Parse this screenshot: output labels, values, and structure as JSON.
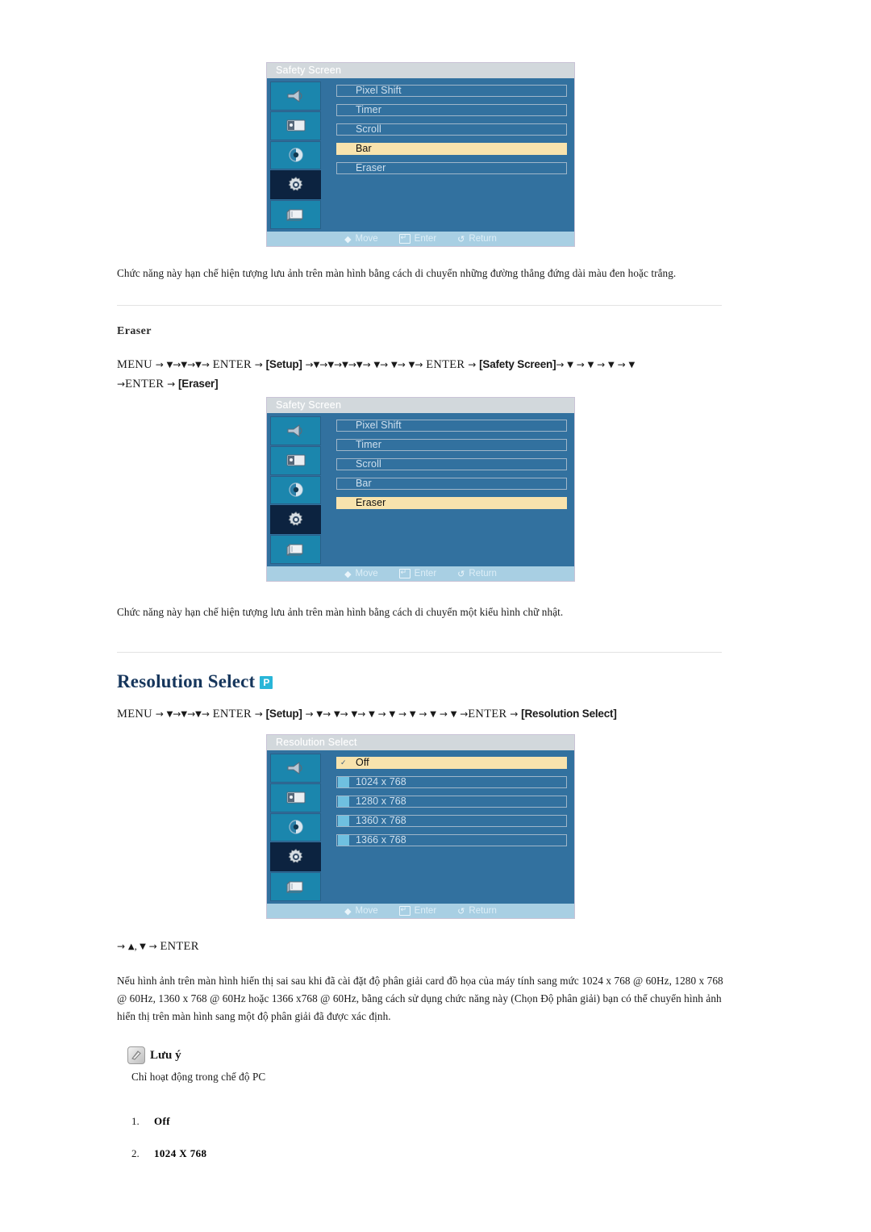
{
  "osd_menus": [
    {
      "title": "Safety Screen",
      "rail_icons": [
        "sound-icon",
        "picture-icon",
        "brightness-icon",
        "setup-gear-icon",
        "multi-display-icon"
      ],
      "selected_rail_index": 3,
      "rows": [
        {
          "label": "Pixel Shift",
          "highlighted": false,
          "swatch": false,
          "check": false
        },
        {
          "label": "Timer",
          "highlighted": false,
          "swatch": false,
          "check": false
        },
        {
          "label": "Scroll",
          "highlighted": false,
          "swatch": false,
          "check": false
        },
        {
          "label": "Bar",
          "highlighted": true,
          "swatch": false,
          "check": false
        },
        {
          "label": "Eraser",
          "highlighted": false,
          "swatch": false,
          "check": false
        }
      ],
      "footer": {
        "move": "Move",
        "enter": "Enter",
        "return": "Return"
      }
    },
    {
      "title": "Safety Screen",
      "rail_icons": [
        "sound-icon",
        "picture-icon",
        "brightness-icon",
        "setup-gear-icon",
        "multi-display-icon"
      ],
      "selected_rail_index": 3,
      "rows": [
        {
          "label": "Pixel Shift",
          "highlighted": false,
          "swatch": false,
          "check": false
        },
        {
          "label": "Timer",
          "highlighted": false,
          "swatch": false,
          "check": false
        },
        {
          "label": "Scroll",
          "highlighted": false,
          "swatch": false,
          "check": false
        },
        {
          "label": "Bar",
          "highlighted": false,
          "swatch": false,
          "check": false
        },
        {
          "label": "Eraser",
          "highlighted": true,
          "swatch": false,
          "check": false
        }
      ],
      "footer": {
        "move": "Move",
        "enter": "Enter",
        "return": "Return"
      }
    },
    {
      "title": "Resolution Select",
      "rail_icons": [
        "sound-icon",
        "picture-icon",
        "brightness-icon",
        "setup-gear-icon",
        "multi-display-icon"
      ],
      "selected_rail_index": 3,
      "rows": [
        {
          "label": "Off",
          "highlighted": true,
          "swatch": false,
          "check": true
        },
        {
          "label": "1024 x 768",
          "highlighted": false,
          "swatch": true,
          "check": false
        },
        {
          "label": "1280 x 768",
          "highlighted": false,
          "swatch": true,
          "check": false
        },
        {
          "label": "1360 x 768",
          "highlighted": false,
          "swatch": true,
          "check": false
        },
        {
          "label": "1366 x 768",
          "highlighted": false,
          "swatch": true,
          "check": false
        }
      ],
      "footer": {
        "move": "Move",
        "enter": "Enter",
        "return": "Return"
      }
    }
  ],
  "bar_description": "Chức năng này hạn chế hiện tượng lưu ảnh trên màn hình bằng cách di chuyển những đường thẳng đứng dài màu đen hoặc trắng.",
  "eraser": {
    "heading": "Eraser",
    "description": "Chức năng này hạn chế hiện tượng lưu ảnh trên màn hình bằng cách di chuyển một kiểu hình chữ nhật.",
    "path": {
      "menu": "MENU",
      "enter": "ENTER",
      "setup_token": "[Setup]",
      "safety_token": "[Safety Screen]",
      "eraser_token": "[Eraser]",
      "arrow": "→",
      "down": "▼"
    }
  },
  "resolution_select": {
    "heading": "Resolution Select",
    "badge": "P",
    "badge_color": "#29b6d8",
    "path": {
      "menu": "MENU",
      "enter": "ENTER",
      "setup_token": "[Setup]",
      "resolution_token": "[Resolution Select]",
      "arrow": "→",
      "down": "▼"
    },
    "updown_line": "→ ▲ , ▼ → ENTER",
    "description": "Nếu hình ảnh trên màn hình hiển thị sai sau khi đã cài đặt độ phân giải card đồ họa của máy tính sang mức 1024 x 768 @ 60Hz, 1280 x 768 @ 60Hz, 1360 x 768 @ 60Hz hoặc 1366 x768 @ 60Hz, bằng cách sử dụng chức năng này (Chọn Độ phân giải) bạn có thể chuyển hình ảnh hiển thị trên màn hình sang một độ phân giải đã được xác định."
  },
  "note": {
    "icon": "note-pen-icon",
    "title": "Lưu ý",
    "text": "Chỉ hoạt động trong chế độ PC"
  },
  "numbered_list": [
    {
      "num": "1.",
      "text": "Off"
    },
    {
      "num": "2.",
      "text": "1024 X 768"
    }
  ]
}
